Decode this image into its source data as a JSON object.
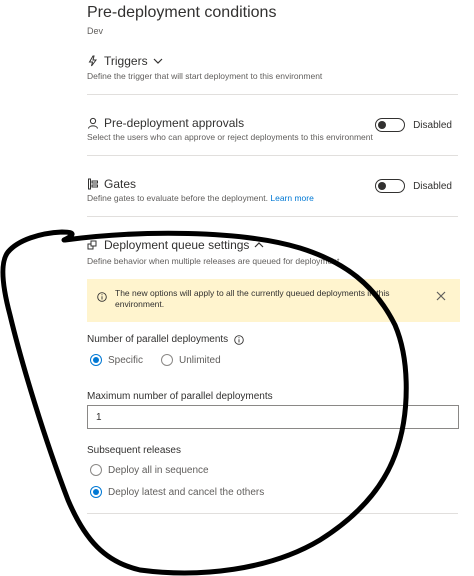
{
  "header": {
    "title": "Pre-deployment conditions",
    "subtitle": "Dev"
  },
  "triggers": {
    "label": "Triggers",
    "description": "Define the trigger that will start deployment to this environment"
  },
  "approvals": {
    "label": "Pre-deployment approvals",
    "description": "Select the users who can approve or reject deployments to this environment",
    "toggle_state": "Disabled"
  },
  "gates": {
    "label": "Gates",
    "description": "Define gates to evaluate before the deployment.",
    "link": "Learn more",
    "toggle_state": "Disabled"
  },
  "queue": {
    "label": "Deployment queue settings",
    "description": "Define behavior when multiple releases are queued for deployment.",
    "banner": "The new options will apply to all the currently queued deployments in this environment.",
    "parallel_label": "Number of parallel deployments",
    "options": [
      "Specific",
      "Unlimited"
    ],
    "selected_option": "Specific",
    "max_label": "Maximum number of parallel deployments",
    "max_value": "1",
    "subsequent_label": "Subsequent releases",
    "subsequent_options": [
      "Deploy all in sequence",
      "Deploy latest and cancel the others"
    ],
    "subsequent_selected": "Deploy latest and cancel the others"
  },
  "colors": {
    "accent": "#0078d4",
    "banner_bg": "#fff4ce",
    "annotation": "#000000"
  }
}
